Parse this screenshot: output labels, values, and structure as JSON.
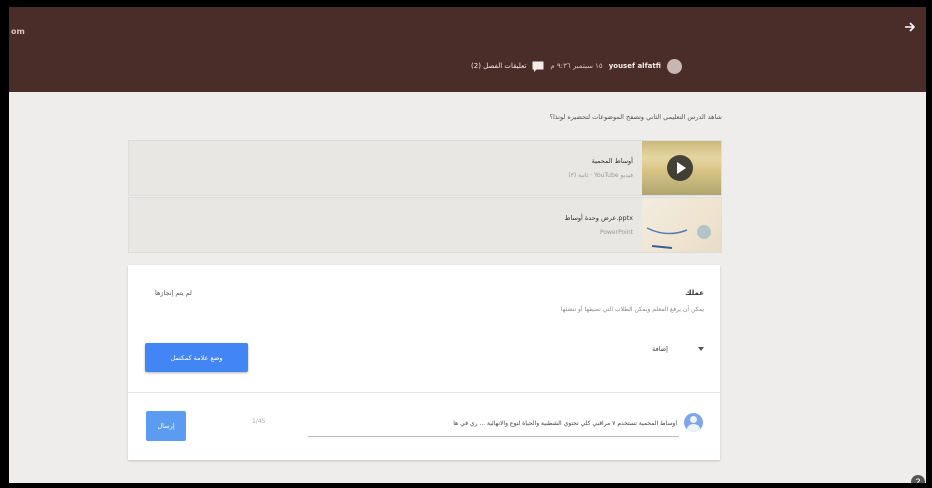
{
  "header": {
    "brand": "om",
    "user_name": "yousef alfatfi",
    "date_text": "١٥ سبتمبر ٩:٣٦ م",
    "comments_label": "تعليقات الفصل (2)"
  },
  "question": {
    "text": "شاهد الدرس التعليمي الثاني وتصفح الموضوعات لتحضيره لونذا؟"
  },
  "attachments": [
    {
      "title": "أوساط المحمية",
      "subtitle": "فيديو YouTube ‏· ثانية (٣)"
    },
    {
      "title": "pptx.عرض وحدة أوساط",
      "subtitle": "PowerPoint"
    }
  ],
  "work": {
    "label": "عملك",
    "description": "يمكن أن يرفع المعلم ويمكن الطلاب التي تضيفها أو تنشئها",
    "due_label": "لم يتم إنجازها",
    "add_dropdown_label": "إضافة",
    "mark_done_button": "وضع علامة كمكتمل"
  },
  "comment": {
    "input_value": "أوساط المحمية تستخدم ٧ مراقبي كلي تحتوي الشطبية والحياة لنوع والانهائية ... ري في ها",
    "counter": "1/45",
    "send_button": "إرسال"
  },
  "icons": [
    "share-icon",
    "user-avatar-icon",
    "comment-icon",
    "play-icon",
    "dropdown-chevron-icon",
    "help-icon"
  ],
  "colors": {
    "header_bg": "#4a2c28",
    "page_bg": "#efedeb",
    "accent": "#4285f4"
  }
}
